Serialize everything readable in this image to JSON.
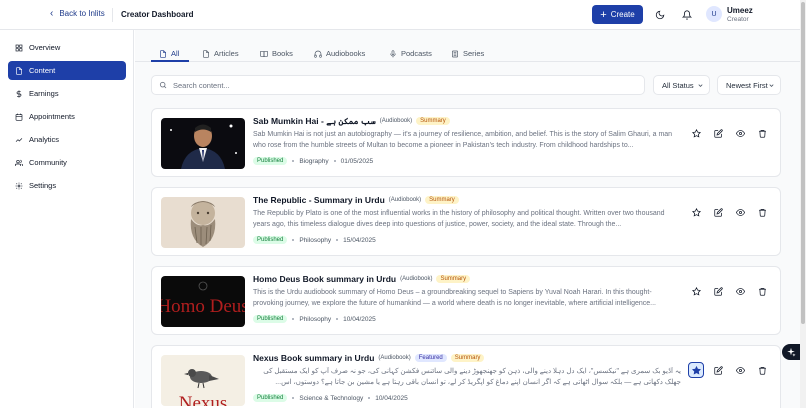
{
  "header": {
    "back_label": "Back to Inlits",
    "title": "Creator Dashboard",
    "create_label": "Create",
    "user": {
      "initial": "U",
      "name": "Umeez",
      "role": "Creator"
    }
  },
  "sidebar": {
    "items": [
      {
        "label": "Overview",
        "icon": "grid-icon",
        "active": false
      },
      {
        "label": "Content",
        "icon": "document-icon",
        "active": true
      },
      {
        "label": "Earnings",
        "icon": "dollar-icon",
        "active": false
      },
      {
        "label": "Appointments",
        "icon": "calendar-icon",
        "active": false
      },
      {
        "label": "Analytics",
        "icon": "chart-icon",
        "active": false
      },
      {
        "label": "Community",
        "icon": "users-icon",
        "active": false
      },
      {
        "label": "Settings",
        "icon": "gear-icon",
        "active": false
      }
    ]
  },
  "tabs": [
    {
      "label": "All",
      "active": true
    },
    {
      "label": "Articles",
      "active": false
    },
    {
      "label": "Books",
      "active": false
    },
    {
      "label": "Audiobooks",
      "active": false
    },
    {
      "label": "Podcasts",
      "active": false
    },
    {
      "label": "Series",
      "active": false
    }
  ],
  "filters": {
    "search_placeholder": "Search content...",
    "status_value": "All Status",
    "sort_value": "Newest First"
  },
  "content": [
    {
      "title": "Sab Mumkin Hai - سب ممکن ہے",
      "type": "(Audiobook)",
      "featured": false,
      "summary_badge": "Summary",
      "description": "Sab Mumkin Hai is not just an autobiography — it's a journey of resilience, ambition, and belief. This is the story of Salim Ghauri, a man who rose from the humble streets of Multan to become a pioneer in Pakistan's tech industry. From childhood hardships to...",
      "status": "Published",
      "category": "Biography",
      "date": "01/05/2025",
      "starred": false
    },
    {
      "title": "The Republic - Summary in Urdu",
      "type": "(Audiobook)",
      "featured": false,
      "summary_badge": "Summary",
      "description": "The Republic by Plato is one of the most influential works in the history of philosophy and political thought. Written over two thousand years ago, this timeless dialogue dives deep into questions of justice, power, society, and the ideal state. Through the...",
      "status": "Published",
      "category": "Philosophy",
      "date": "15/04/2025",
      "starred": false
    },
    {
      "title": "Homo Deus Book summary in Urdu",
      "type": "(Audiobook)",
      "featured": false,
      "summary_badge": "Summary",
      "description": "This is the Urdu audiobook summary of Homo Deus – a groundbreaking sequel to Sapiens by Yuval Noah Harari. In this thought-provoking journey, we explore the future of humankind — a world where death is no longer inevitable, where artificial intelligence...",
      "status": "Published",
      "category": "Philosophy",
      "date": "10/04/2025",
      "thumb_text": "Homo Deus",
      "starred": false
    },
    {
      "title": "Nexus Book summary in Urdu",
      "type": "(Audiobook)",
      "featured": true,
      "featured_badge": "Featured",
      "summary_badge": "Summary",
      "description": "یہ آڈیو بک سمری ہے \"نیکسس\"، ایک دل دہلا دینے والی، ذہن کو جھنجھوڑ دینے والی سائنس فکشن کہانی کی، جو نہ صرف آپ کو ایک مستقبل کی جھلک دکھاتی ہے — بلکہ سوال اٹھاتی ہے کہ اگر انسان اپنے دماغ کو اپگریڈ کر لے، تو انسان باقی رہتا ہے یا مشین بن جاتا ہے؟ دوستوں، اس...",
      "status": "Published",
      "category": "Science & Technology",
      "date": "10/04/2025",
      "thumb_text": "Nexus",
      "starred": true
    }
  ],
  "colors": {
    "accent": "#1e3fa8",
    "published_bg": "#dcfce7",
    "summary_bg": "#fef3c7",
    "featured_bg": "#e0e7ff"
  }
}
